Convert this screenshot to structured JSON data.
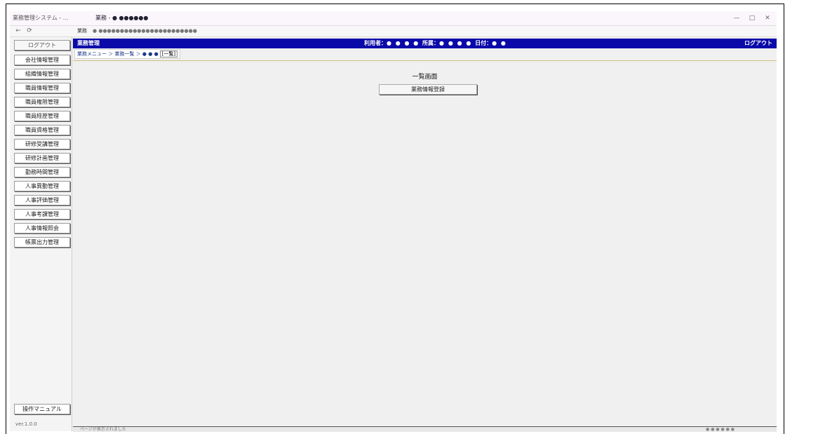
{
  "browser": {
    "tabs": [
      "業務管理システム - …",
      "業務 - ● ●●●●●●"
    ],
    "address_label": "業務",
    "address": "● ●●●●●●●●●●●●●●●●●●●●●●●",
    "window_controls": [
      "—",
      "□",
      "✕"
    ],
    "nav": [
      "←",
      "⟳"
    ]
  },
  "sidebar": {
    "items": [
      "ログアウト",
      "会社情報管理",
      "組織情報管理",
      "職員情報管理",
      "職員権限管理",
      "職員経歴管理",
      "職員資格管理",
      "研修受講管理",
      "研修計画管理",
      "勤務時間管理",
      "人事異動管理",
      "人事評価管理",
      "人事考課管理",
      "人事情報照会",
      "帳票出力管理"
    ],
    "bottom_button": "操作マニュアル",
    "footer": "ver.1.0.0"
  },
  "header": {
    "app_name": "業務管理",
    "info": "利用者：● ● ● ●  所属：● ● ● ●  日付：● ●",
    "right": "ログアウト"
  },
  "breadcrumb": {
    "path": "業務メニュー ＞ 業務一覧 ＞ ● ● ●",
    "current": "[一覧]"
  },
  "main": {
    "title": "一覧画面",
    "button": "業務情報登録"
  },
  "statusbar": {
    "left": "ページが表示されました",
    "right": "● ● ● ● ● ●"
  }
}
